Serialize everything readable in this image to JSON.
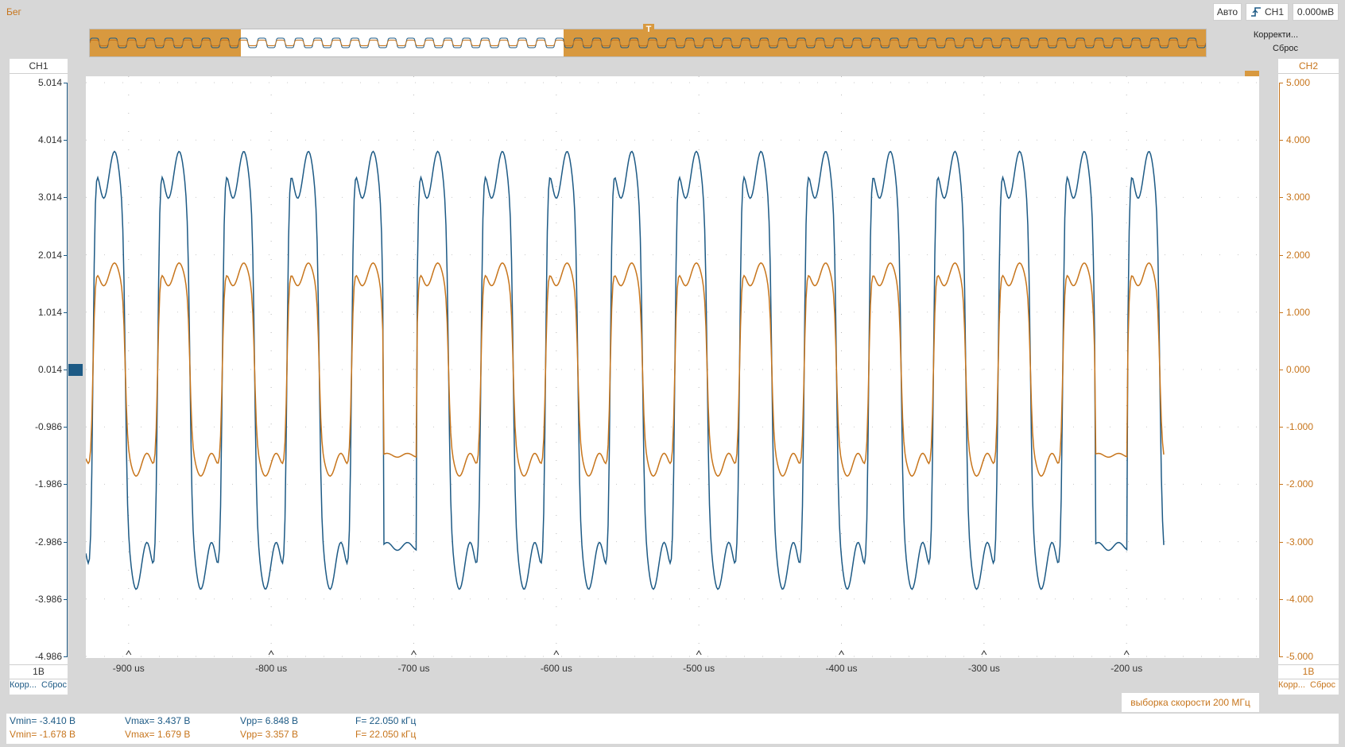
{
  "toolbar": {
    "run_state": "Бег",
    "mode": "Авто",
    "trigger_channel": "CH1",
    "trigger_level": "0.000мВ",
    "overview_adjust": "Корректи...",
    "overview_reset": "Сброс"
  },
  "left_panel": {
    "channel": "CH1",
    "ticks": [
      "5.014",
      "4.014",
      "3.014",
      "2.014",
      "1.014",
      "0.014",
      "-0.986",
      "-1.986",
      "-2.986",
      "-3.986",
      "-4.986"
    ],
    "scale": "1В",
    "adjust": "Корр...",
    "reset": "Сброс"
  },
  "right_panel": {
    "channel": "CH2",
    "ticks": [
      "5.000",
      "4.000",
      "3.000",
      "2.000",
      "1.000",
      "0.000",
      "-1.000",
      "-2.000",
      "-3.000",
      "-4.000",
      "-5.000"
    ],
    "scale": "1В",
    "adjust": "Корр...",
    "reset": "Сброс"
  },
  "x_axis": {
    "ticks": [
      "-900 us",
      "-800 us",
      "-700 us",
      "-600 us",
      "-500 us",
      "-400 us",
      "-300 us",
      "-200 us"
    ]
  },
  "sample_rate": "выборка скорости 200 МГц",
  "measurements": {
    "ch1": {
      "vmin": "Vmin= -3.410 В",
      "vmax": "Vmax= 3.437 В",
      "vpp": "Vpp= 6.848 В",
      "freq": "F= 22.050 кГц"
    },
    "ch2": {
      "vmin": "Vmin= -1.678 В",
      "vmax": "Vmax= 1.679 В",
      "vpp": "Vpp= 3.357 В",
      "freq": "F= 22.050 кГц"
    }
  },
  "colors": {
    "ch1": "#1d5a85",
    "ch2": "#c7751c",
    "accent": "#d8993f"
  },
  "icons": {
    "trigger_edge": "rising-edge-icon",
    "trigger_marker": "trigger-T-icon",
    "ch1_marker": "ch1-offset-marker-icon",
    "ch2_marker": "ch2-offset-marker-icon"
  },
  "chart_data": {
    "type": "line",
    "x_unit": "us",
    "xlim": [
      -930,
      -107
    ],
    "y_left": {
      "label": "CH1",
      "ylim": [
        -4.986,
        5.014
      ]
    },
    "y_right": {
      "label": "CH2",
      "ylim": [
        -5.0,
        5.0
      ]
    },
    "series": [
      {
        "name": "CH1",
        "color": "#1d5a85",
        "amplitude_peak": 3.437,
        "min": -3.41,
        "frequency_khz": 22.05,
        "period_us": 45.35
      },
      {
        "name": "CH2",
        "color": "#c7751c",
        "amplitude_peak": 1.679,
        "min": -1.678,
        "frequency_khz": 22.05,
        "period_us": 45.35
      }
    ],
    "grid": true
  }
}
